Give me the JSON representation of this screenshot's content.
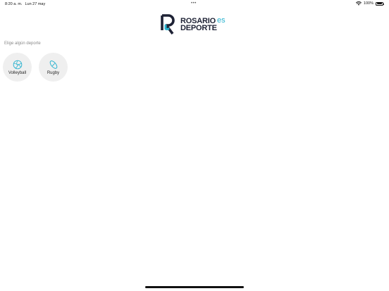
{
  "status_bar": {
    "time": "8:20 a. m.",
    "date": "Lun 27 may",
    "multitask_indicator": "•••",
    "battery": "100%"
  },
  "logo": {
    "line1": "ROSARIO",
    "line2": "DEPORTE",
    "suffix": "es",
    "colors": {
      "dark": "#1e2235",
      "accent": "#2bb3cf"
    }
  },
  "main": {
    "section_label": "Elige algún deporte",
    "sports": [
      {
        "label": "Volleyball",
        "icon": "volleyball-icon"
      },
      {
        "label": "Rugby",
        "icon": "rugby-ball-icon"
      }
    ]
  },
  "colors": {
    "icon_accent": "#2bb3cf",
    "card_bg": "#efefef"
  }
}
